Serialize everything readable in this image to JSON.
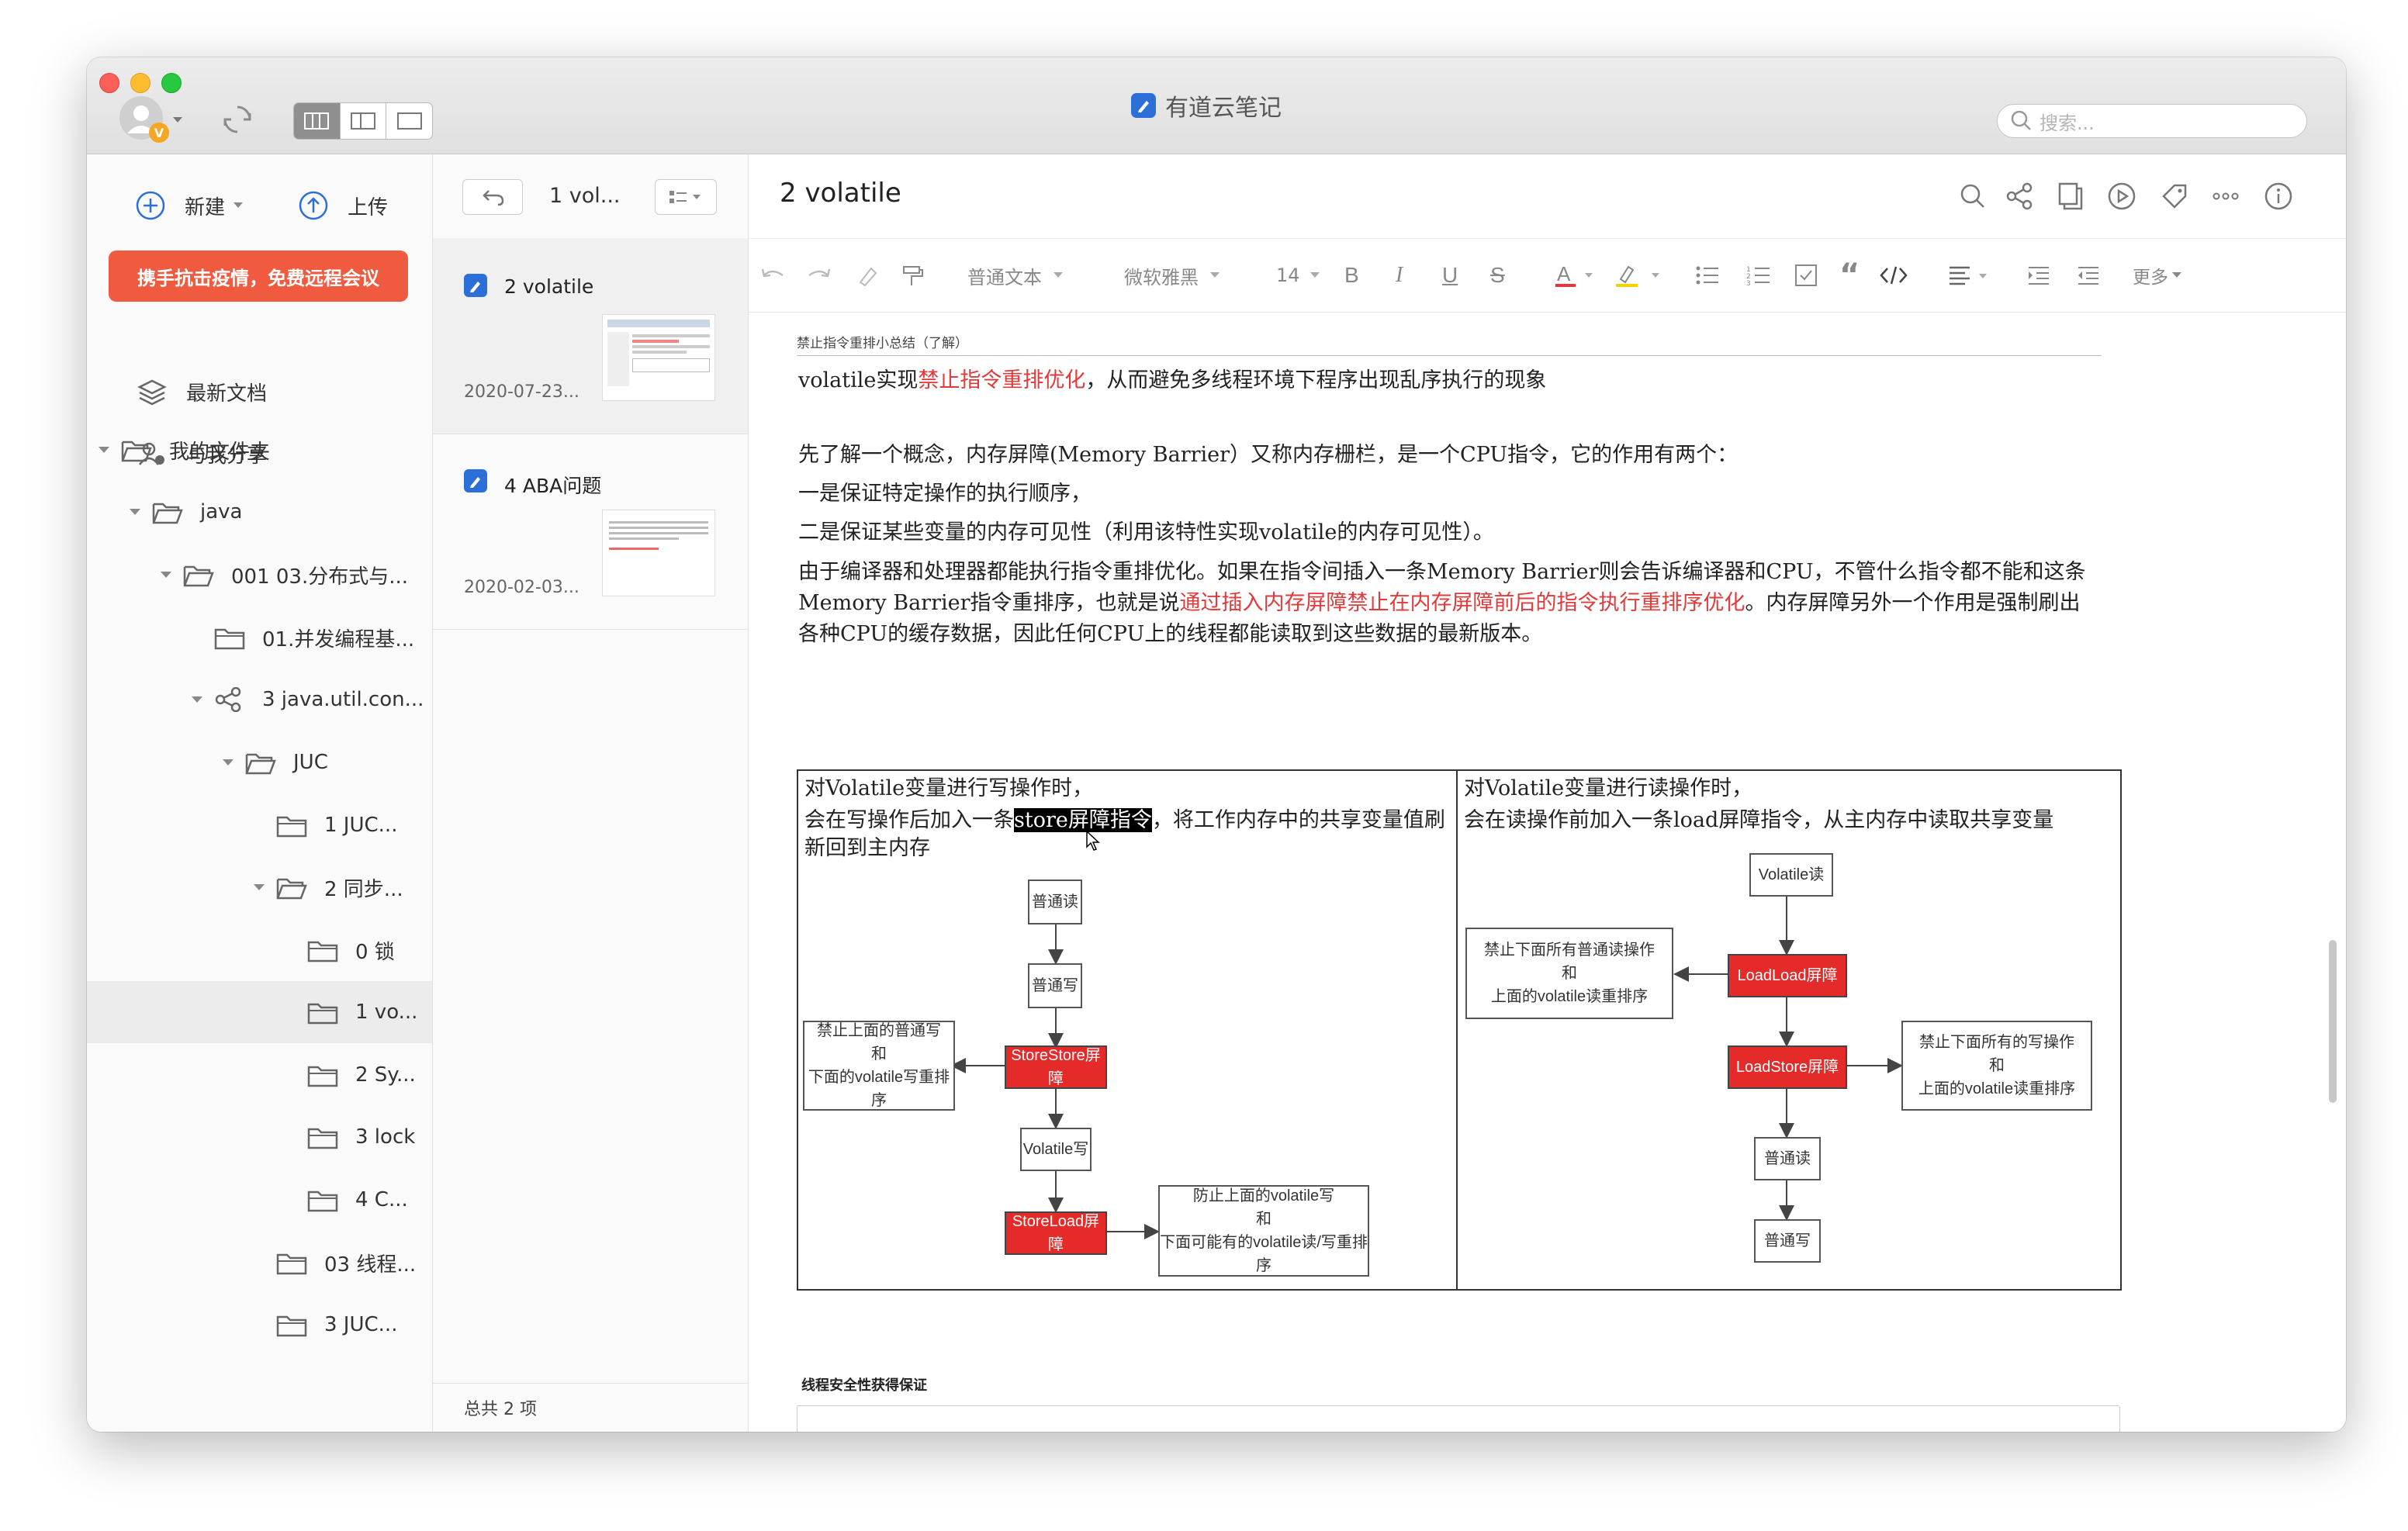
{
  "app": {
    "title": "有道云笔记",
    "search_placeholder": "搜索..."
  },
  "sidebar": {
    "new_label": "新建",
    "upload_label": "上传",
    "promo": "携手抗击疫情，免费远程会议",
    "items": [
      {
        "label": "最新文档"
      },
      {
        "label": "与我分享"
      },
      {
        "label": "我的文件夹"
      },
      {
        "label": "java"
      },
      {
        "label": "001 03.分布式与..."
      },
      {
        "label": "01.并发编程基..."
      },
      {
        "label": "3 java.util.con..."
      },
      {
        "label": "JUC"
      },
      {
        "label": "1 JUC..."
      },
      {
        "label": "2 同步..."
      },
      {
        "label": "0 锁"
      },
      {
        "label": "1 vo..."
      },
      {
        "label": "2 Sy..."
      },
      {
        "label": "3 lock"
      },
      {
        "label": "4 C..."
      },
      {
        "label": "03 线程..."
      },
      {
        "label": "3 JUC..."
      }
    ]
  },
  "notelist": {
    "folder_title": "1 vol...",
    "notes": [
      {
        "title": "2 volatile",
        "date": "2020-07-23..."
      },
      {
        "title": "4 ABA问题",
        "date": "2020-02-03..."
      }
    ],
    "footer": "总共 2 项"
  },
  "editor": {
    "title": "2 volatile",
    "toolbar": {
      "style": "普通文本",
      "font": "微软雅黑",
      "size": "14",
      "more": "更多"
    },
    "section_heading": "禁止指令重排小总结（了解）",
    "p1": {
      "a": "volatile实现",
      "b": "禁止指令重排优化",
      "c": "，从而避免多线程环境下程序出现乱序执行的现象"
    },
    "p2": "先了解一个概念，内存屏障(Memory Barrier）又称内存栅栏，是一个CPU指令，它的作用有两个：",
    "p3": "一是保证特定操作的执行顺序，",
    "p4": "二是保证某些变量的内存可见性（利用该特性实现volatile的内存可见性）。",
    "p5": {
      "a": "由于编译器和处理器都能执行指令重排优化。如果在指令间插入一条Memory Barrier则会告诉编译器和CPU，不管什么指令都不能和这条Memory Barrier指令重排序，也就是说",
      "b": "通过插入内存屏障禁止在内存屏障前后的指令执行重排序优化",
      "c": "。内存屏障另外一个作用是强制刷出各种CPU的缓存数据，因此任何CPU上的线程都能读取到这些数据的最新版本。"
    },
    "table": {
      "left": {
        "h1": "对Volatile变量进行写操作时，",
        "h2a": "会在写操作后加入一条",
        "h2sel": "store屏障指令",
        "h2b": "，将工作内存中的共享变量值刷新回到主内存",
        "boxes": {
          "b1": "普通读",
          "b2": "普通写",
          "b3": "StoreStore屏障",
          "b4": "Volatile写",
          "b5": "StoreLoad屏障",
          "n1a": "禁止上面的普通写",
          "n1b": "和",
          "n1c": "下面的volatile写重排序",
          "n2a": "防止上面的volatile写",
          "n2b": "和",
          "n2c": "下面可能有的volatile读/写重排序"
        }
      },
      "right": {
        "h1": "对Volatile变量进行读操作时，",
        "h2": "会在读操作前加入一条load屏障指令，从主内存中读取共享变量",
        "boxes": {
          "b1": "Volatile读",
          "b2": "LoadLoad屏障",
          "b3": "LoadStore屏障",
          "b4": "普通读",
          "b5": "普通写",
          "n1a": "禁止下面所有普通读操作",
          "n1b": "和",
          "n1c": "上面的volatile读重排序",
          "n2a": "禁止下面所有的写操作",
          "n2b": "和",
          "n2c": "上面的volatile读重排序"
        }
      }
    },
    "section2": "线程安全性获得保证"
  },
  "colors": {
    "accent": "#2c6fd8",
    "promo": "#f05a3f",
    "barrier": "#e52a2a"
  }
}
